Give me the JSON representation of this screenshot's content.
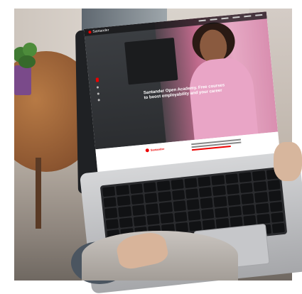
{
  "scene": {
    "description_alt": "",
    "site": {
      "brand": "Santander",
      "headline": "Santander Open Academy. Free courses to boost employability and your career",
      "nav_links_count": 6
    }
  },
  "colors": {
    "brand_red": "#ec0000",
    "hero_pink": "#e9a5c6",
    "laptop_frame": "#1f2124",
    "wood_table": "#8b5530"
  }
}
